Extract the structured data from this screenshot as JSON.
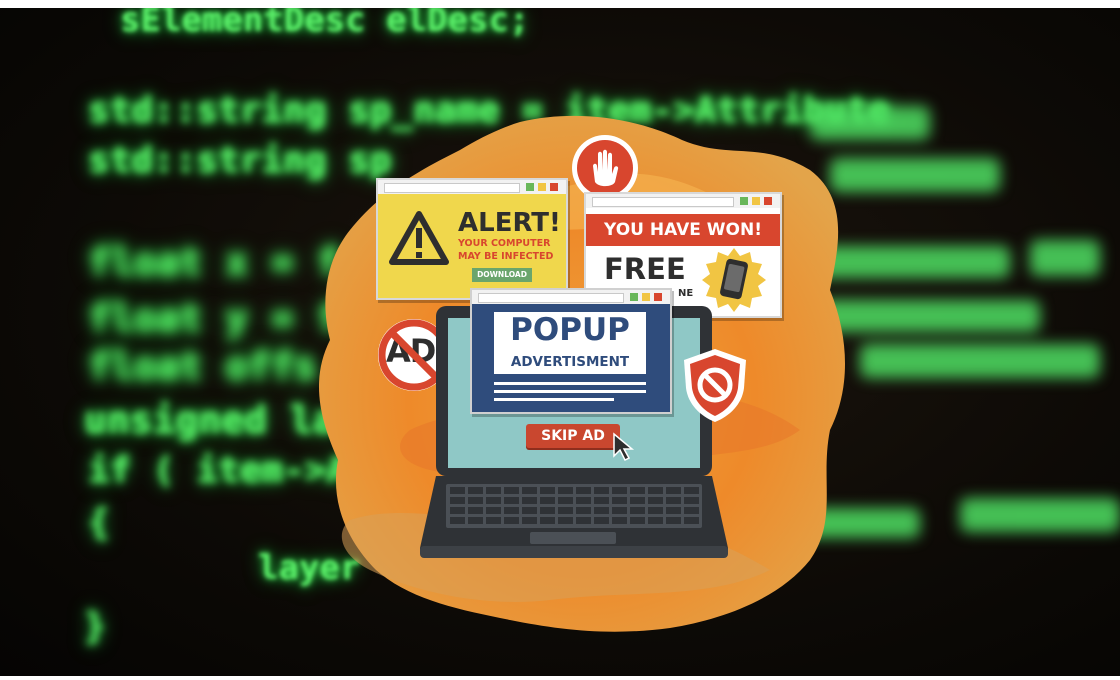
{
  "background": {
    "code_lines": [
      "sElementDesc elDesc;",
      "std::string sp_name = item->Attribute",
      "std::string sp",
      "float x = f",
      "float y = f",
      "float offs",
      "unsigned la",
      "if ( item->A",
      "{",
      "layer",
      "}"
    ]
  },
  "alert_popup": {
    "title": "ALERT!",
    "line1": "YOUR COMPUTER",
    "line2": "MAY BE INFECTED",
    "button": "DOWNLOAD"
  },
  "won_popup": {
    "banner": "YOU HAVE WON!",
    "free": "FREE",
    "partial": "NE"
  },
  "laptop_popup": {
    "title": "POPUP",
    "subtitle": "ADVERTISMENT",
    "skip_button": "SKIP AD"
  },
  "no_ad_sign": {
    "text": "AD"
  },
  "colors": {
    "code_green": "#5cf06a",
    "alert_yellow": "#f0d74c",
    "banner_red": "#d8462e",
    "popup_navy": "#2f4c7c",
    "laptop_dark": "#2f3236",
    "screen_teal": "#8fc8c6",
    "splash_orange": "#f29a2e"
  }
}
